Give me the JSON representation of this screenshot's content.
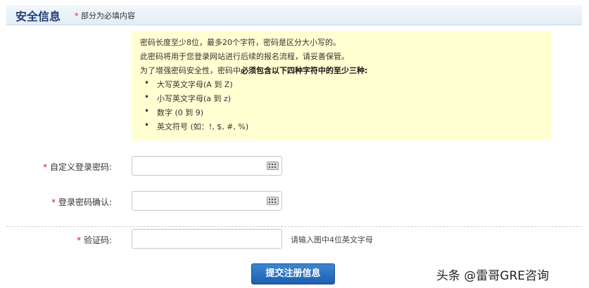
{
  "header": {
    "title": "安全信息",
    "required_mark": "*",
    "required_note": "部分为必填内容"
  },
  "notice": {
    "line1": "密码长度至少8位，最多20个字符，密码是区分大小写的。",
    "line2": "此密码将用于您登录网站进行后续的报名流程，请妥善保管。",
    "line3_prefix": "为了增强密码安全性，密码中",
    "line3_bold": "必须包含以下四种字符中的至少三种:",
    "rules": [
      "大写英文字母(A 到 Z)",
      "小写英文字母(a 到 z)",
      "数字 (0 到 9)",
      "英文符号 (如：!, $, #, %)"
    ]
  },
  "form": {
    "required_mark": "*",
    "password_label": "自定义登录密码:",
    "password_value": "",
    "confirm_label": "登录密码确认:",
    "confirm_value": "",
    "captcha_label": "验证码:",
    "captcha_value": "",
    "captcha_hint": "请输入图中4位英文字母",
    "submit_label": "提交注册信息"
  },
  "watermark": "头条 @雷哥GRE咨询",
  "colors": {
    "header_title": "#1f3f73",
    "required": "#d02020",
    "notice_bg": "#ffffd2",
    "button": "#1b5fb0"
  }
}
